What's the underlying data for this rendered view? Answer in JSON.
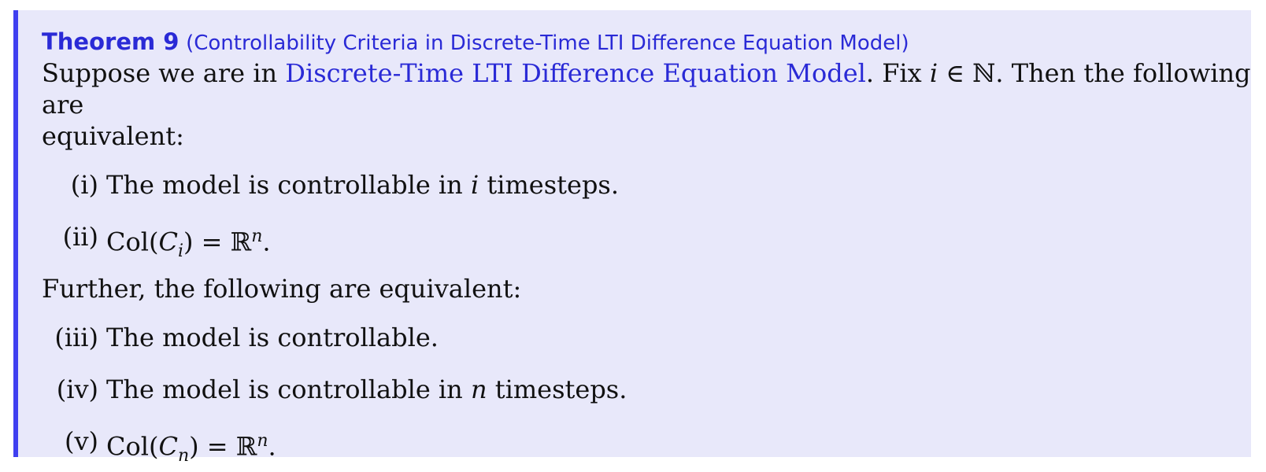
{
  "theorem": {
    "label": "Theorem 9",
    "subtitle": "(Controllability Criteria in Discrete-Time LTI Difference Equation Model)",
    "intro_pre": "Suppose we are in ",
    "intro_link": "Discrete-Time LTI Difference Equation Model",
    "intro_post_1": ". Fix ",
    "intro_var": "i",
    "intro_post_2": " ∈ ℕ. Then the following are",
    "intro_line2": "equivalent:",
    "items_a": [
      {
        "label": "(i)",
        "pre": "The model is controllable in ",
        "var": "i",
        "post": " timesteps."
      },
      {
        "label": "(ii)",
        "pre": "Col(",
        "cal": "C",
        "sub": "i",
        "post": ") = ℝ",
        "sup": "n",
        "end": "."
      }
    ],
    "further": "Further, the following are equivalent:",
    "items_b": [
      {
        "label": "(iii)",
        "text": "The model is controllable."
      },
      {
        "label": "(iv)",
        "pre": "The model is controllable in ",
        "var": "n",
        "post": " timesteps."
      },
      {
        "label": "(v)",
        "pre": "Col(",
        "cal": "C",
        "sub": "n",
        "post": ") = ℝ",
        "sup": "n",
        "end": "."
      }
    ]
  }
}
